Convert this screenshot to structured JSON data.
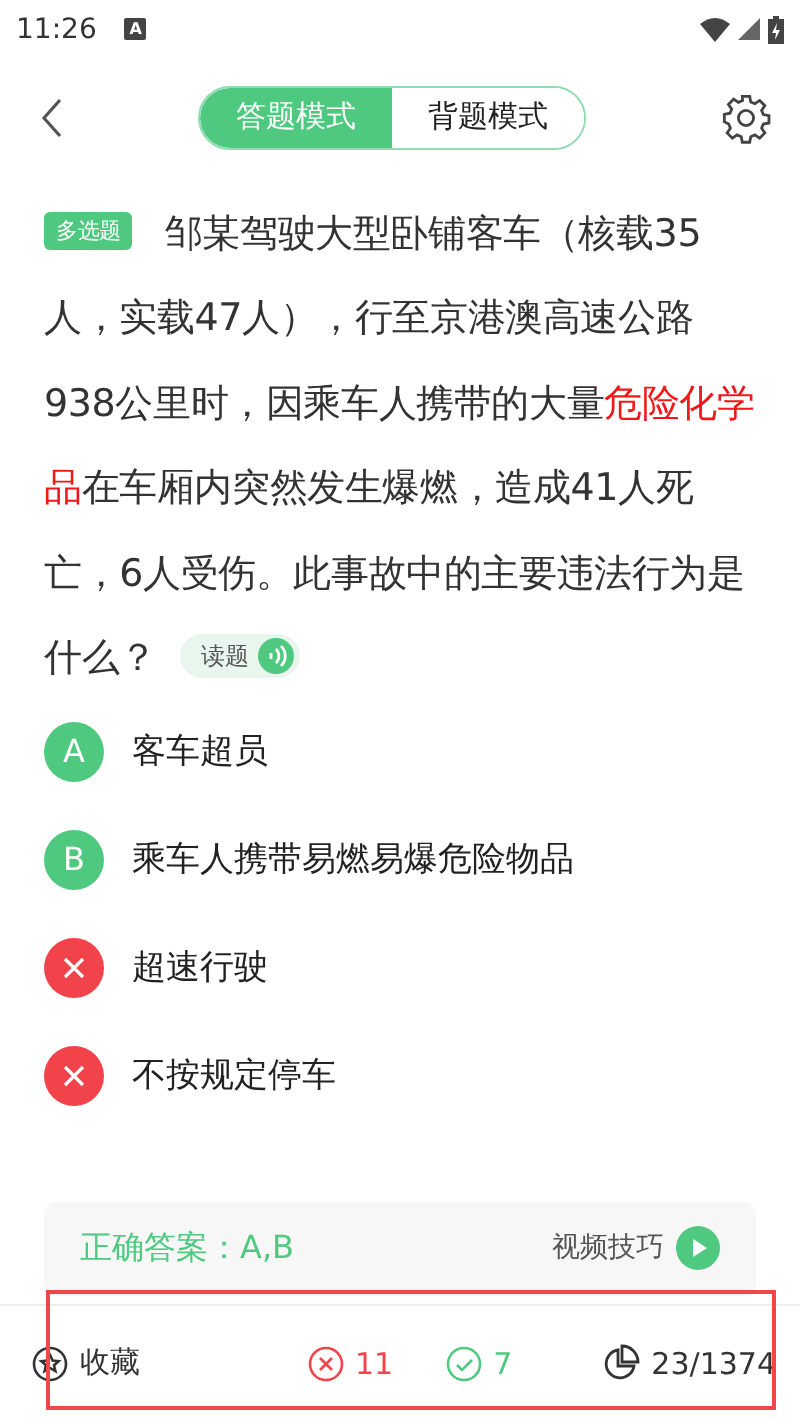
{
  "status_bar": {
    "time": "11:26",
    "notification": "A"
  },
  "header": {
    "modes": [
      {
        "label": "答题模式",
        "selected": true
      },
      {
        "label": "背题模式",
        "selected": false
      }
    ]
  },
  "question": {
    "type_tag": "多选题",
    "segments": [
      {
        "text": "邹某驾驶大型卧铺客车（核载35人，实载47人），行至京港澳高速公路938公里时，因乘车人携带的大量",
        "highlight": false
      },
      {
        "text": "危险化学品",
        "highlight": true
      },
      {
        "text": "在车厢内突然发生爆燃，造成41人死亡，6人受伤。此事故中的主要违法行为是什么？",
        "highlight": false
      }
    ],
    "read_button": "读题"
  },
  "options": [
    {
      "marker": "A",
      "text": "客车超员",
      "correct": true
    },
    {
      "marker": "B",
      "text": "乘车人携带易燃易爆危险物品",
      "correct": true
    },
    {
      "text": "超速行驶",
      "correct": false
    },
    {
      "text": "不按规定停车",
      "correct": false
    }
  ],
  "answer": {
    "text": "正确答案：A,B",
    "video_link": "视频技巧"
  },
  "bottom_bar": {
    "favorite": "收藏",
    "wrong_count": "11",
    "right_count": "7",
    "progress": "23/1374"
  }
}
